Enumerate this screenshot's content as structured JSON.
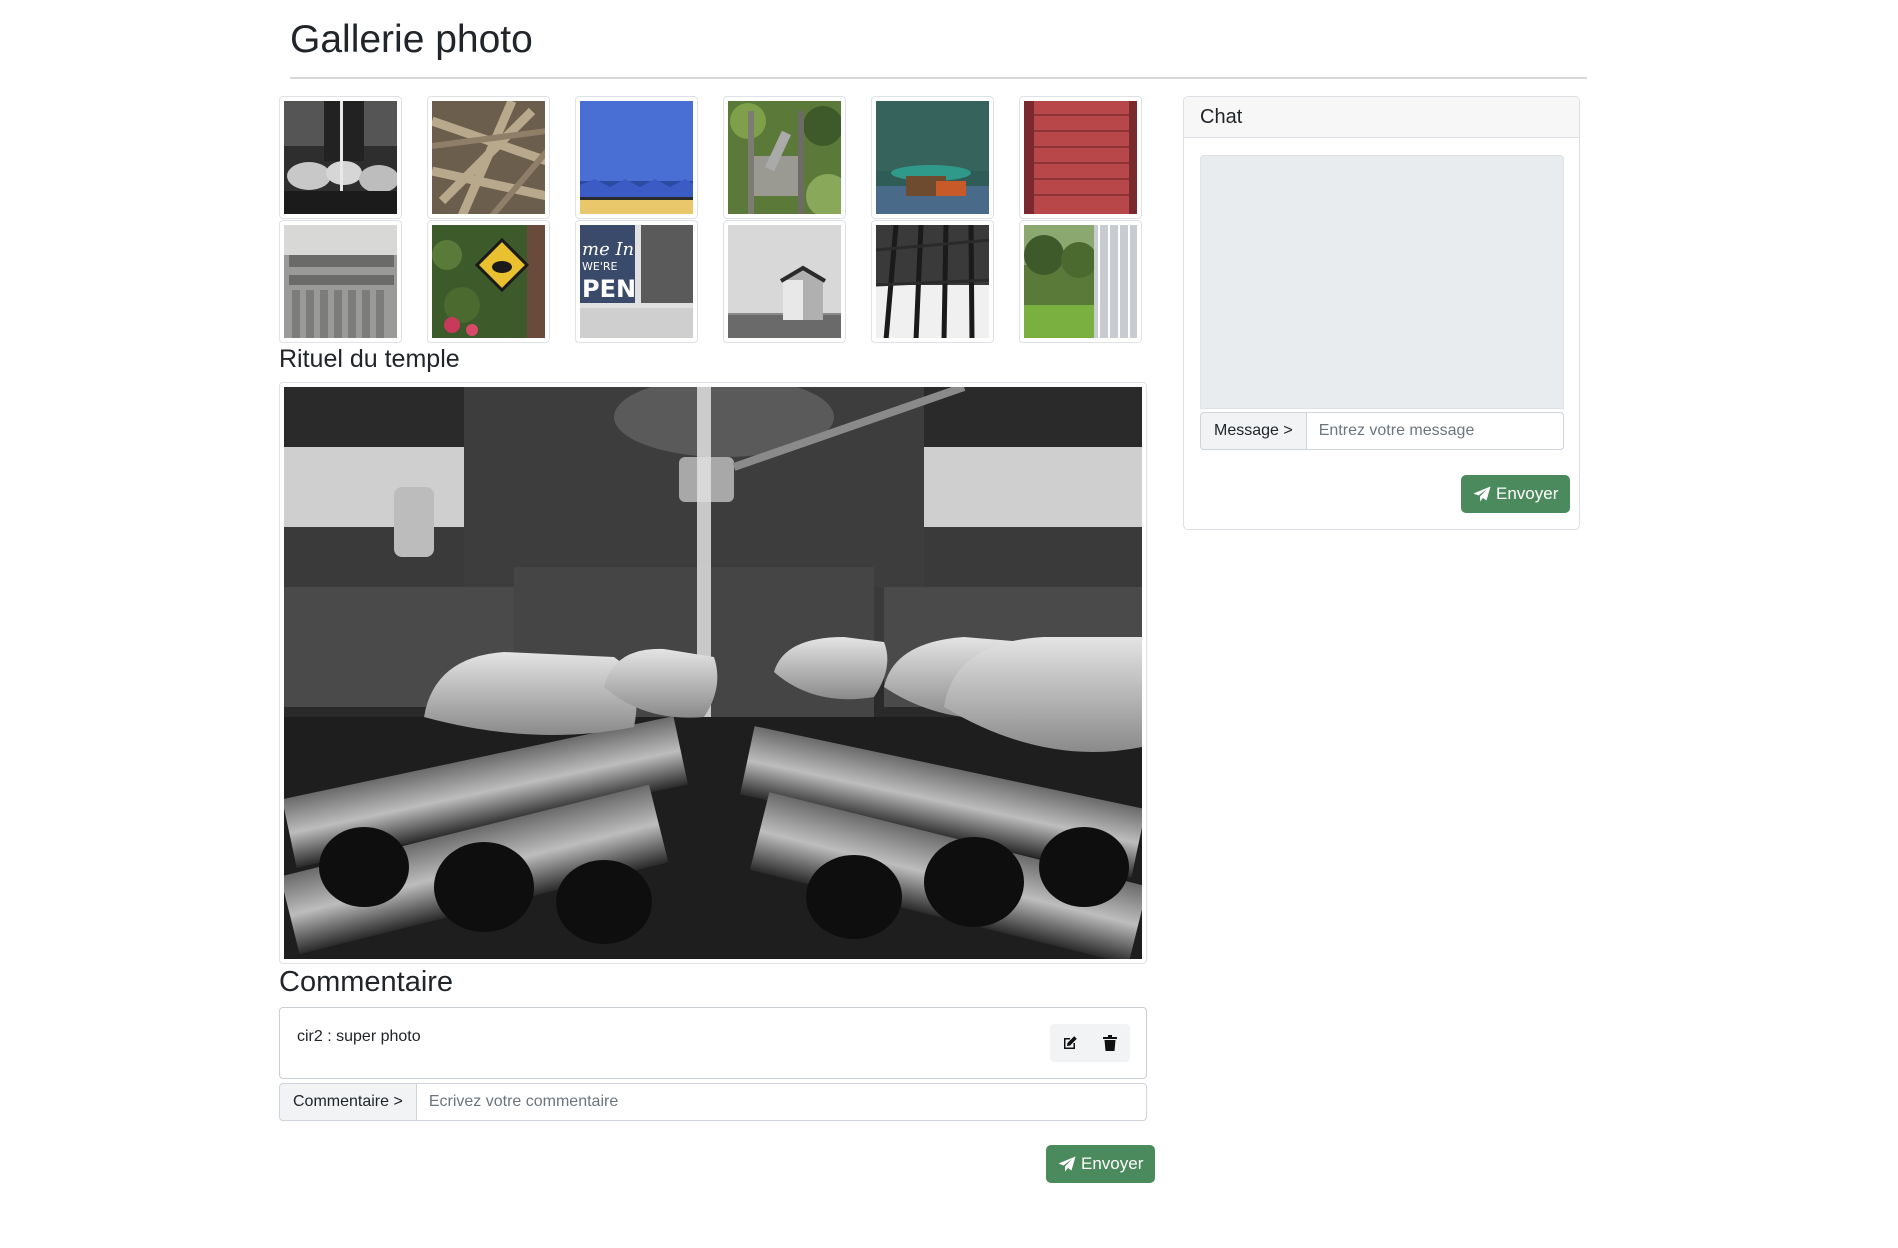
{
  "page": {
    "title": "Gallerie photo"
  },
  "thumbnails": [
    {
      "id": "t1",
      "subject": "temple-water-ladles"
    },
    {
      "id": "t2",
      "subject": "wooden-planks"
    },
    {
      "id": "t3",
      "subject": "blue-sky-yellow"
    },
    {
      "id": "t4",
      "subject": "metal-gate-greenery"
    },
    {
      "id": "t5",
      "subject": "boat-bollard-sea"
    },
    {
      "id": "t6",
      "subject": "red-shutter"
    },
    {
      "id": "t7",
      "subject": "wooden-bench"
    },
    {
      "id": "t8",
      "subject": "ivy-sign"
    },
    {
      "id": "t9",
      "subject": "open-sign"
    },
    {
      "id": "t10",
      "subject": "beach-hut"
    },
    {
      "id": "t11",
      "subject": "railing-bw"
    },
    {
      "id": "t12",
      "subject": "garden-gate"
    }
  ],
  "thumb_text": {
    "t9_line1": "me In",
    "t9_line2": "WE'RE",
    "t9_line3": "PEN"
  },
  "selected_photo": {
    "title": "Rituel du temple"
  },
  "comments": {
    "heading": "Commentaire",
    "items": [
      {
        "text": "cir2 : super photo"
      }
    ],
    "input_label": "Commentaire >",
    "input_placeholder": "Ecrivez votre commentaire",
    "send_label": "Envoyer"
  },
  "chat": {
    "header": "Chat",
    "input_label": "Message >",
    "input_placeholder": "Entrez votre message",
    "send_label": "Envoyer"
  },
  "colors": {
    "send_button": "#4a8a5c",
    "chat_area": "#e9ecef",
    "input_addon": "#f1f3f5"
  },
  "icons": {
    "edit": "edit-icon",
    "delete": "trash-icon",
    "send": "paper-plane-icon"
  }
}
